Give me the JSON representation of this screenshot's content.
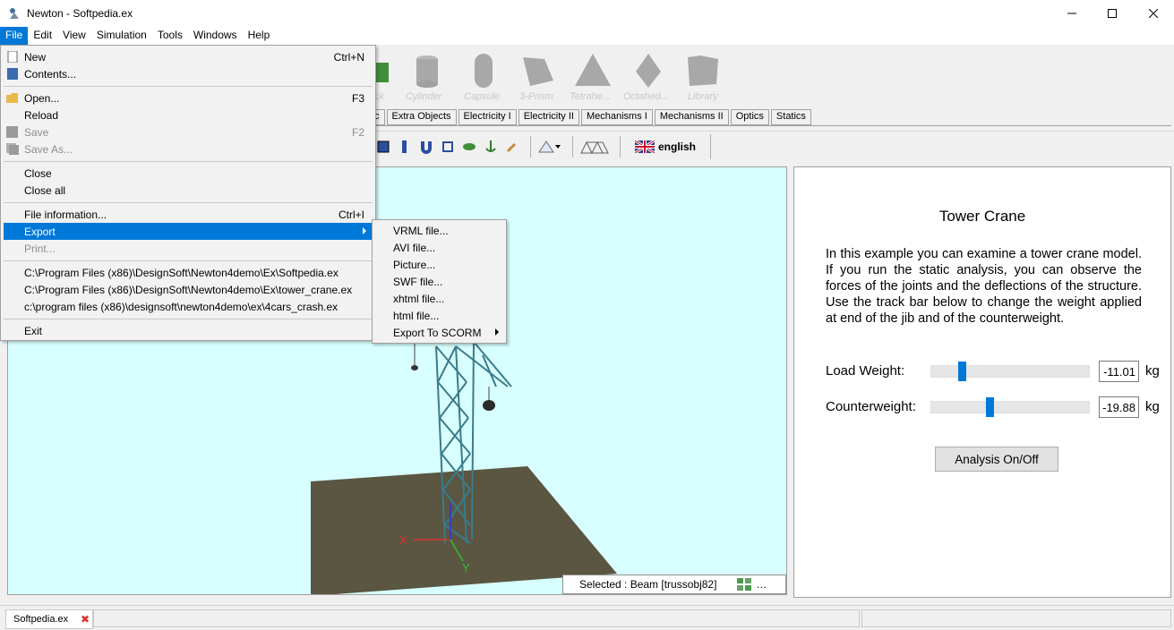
{
  "window": {
    "title": "Newton - Softpedia.ex",
    "minimize": "—",
    "maximize": "☐",
    "close": "✕"
  },
  "menubar": [
    "File",
    "Edit",
    "View",
    "Simulation",
    "Tools",
    "Windows",
    "Help"
  ],
  "shapes": [
    "ck",
    "Cylinder",
    "Capsule",
    "3-Prism",
    "Tetrahe...",
    "Octahed...",
    "Library"
  ],
  "tabs": [
    "c",
    "Extra Objects",
    "Electricity I",
    "Electricity II",
    "Mechanisms I",
    "Mechanisms II",
    "Optics",
    "Statics"
  ],
  "language": "english",
  "file_menu": {
    "new": {
      "label": "New",
      "shortcut": "Ctrl+N"
    },
    "contents": {
      "label": "Contents..."
    },
    "open": {
      "label": "Open...",
      "shortcut": "F3"
    },
    "reload": {
      "label": "Reload"
    },
    "save": {
      "label": "Save",
      "shortcut": "F2"
    },
    "save_as": {
      "label": "Save As..."
    },
    "close": {
      "label": "Close"
    },
    "close_all": {
      "label": "Close all"
    },
    "file_info": {
      "label": "File information...",
      "shortcut": "Ctrl+I"
    },
    "export": {
      "label": "Export"
    },
    "print": {
      "label": "Print..."
    },
    "recent": [
      "C:\\Program Files (x86)\\DesignSoft\\Newton4demo\\Ex\\Softpedia.ex",
      "C:\\Program Files (x86)\\DesignSoft\\Newton4demo\\Ex\\tower_crane.ex",
      "c:\\program files (x86)\\designsoft\\newton4demo\\ex\\4cars_crash.ex"
    ],
    "exit": {
      "label": "Exit"
    }
  },
  "export_menu": [
    "VRML file...",
    "AVI file...",
    "Picture...",
    "SWF file...",
    "xhtml file...",
    "html file...",
    "Export To SCORM"
  ],
  "viewport": {
    "selected": "Selected : Beam [trussobj82]",
    "axis_x": "X",
    "axis_y": "Y"
  },
  "panel": {
    "title": "Tower Crane",
    "description": "In this example you can examine a tower crane model. If you run the static analysis, you can observe the forces of the joints and the deflections of the structure. Use the track bar below to change the weight applied at end of the jib and of the counterweight.",
    "load_weight": {
      "label": "Load Weight:",
      "value": "-11.01",
      "unit": "kg",
      "position": 0.18
    },
    "counterweight": {
      "label": "Counterweight:",
      "value": "-19.88",
      "unit": "kg",
      "position": 0.36
    },
    "analysis_button": "Analysis On/Off"
  },
  "statusbar": {
    "doc_tab": "Softpedia.ex"
  },
  "colors": {
    "accent": "#0078d7",
    "viewport_bg": "#d8ffff",
    "ground": "#5a5642",
    "truss": "#3a7b8a"
  }
}
